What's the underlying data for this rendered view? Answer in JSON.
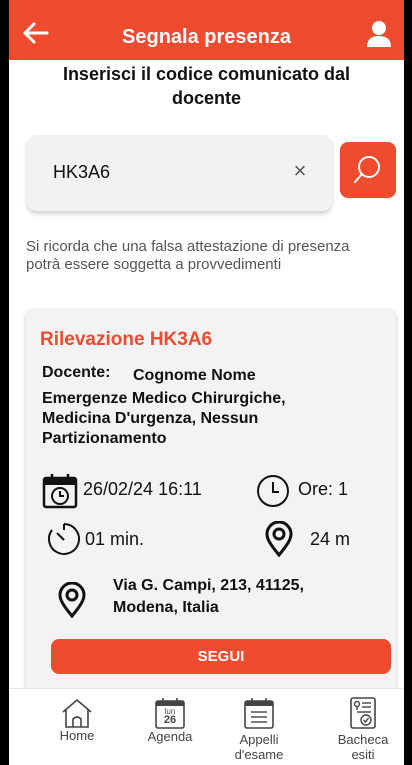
{
  "header": {
    "title": "Segnala presenza",
    "back_icon": "arrow-left-icon",
    "user_icon": "user-icon",
    "color": "#ef4c2f"
  },
  "instruction": "Inserisci il codice comunicato dal docente",
  "search": {
    "value": "HK3A6",
    "clear_label": "×",
    "search_icon": "search-icon"
  },
  "disclaimer": "Si ricorda che una falsa attestazione di presenza potrà essere soggetta a provvedimenti",
  "card": {
    "title": "Rilevazione HK3A6",
    "docente_label": "Docente:",
    "docente_name": "Cognome Nome",
    "course": "Emergenze Medico Chirurgiche, Medicina D'urgenza, Nessun Partizionamento",
    "datetime": "26/02/24 16:11",
    "hours": "Ore: 1",
    "duration": "01 min.",
    "distance": "24 m",
    "address": "Via G. Campi, 213, 41125, Modena, Italia",
    "button": "SEGUI"
  },
  "nav": {
    "home": "Home",
    "agenda": "Agenda",
    "agenda_day": "lun",
    "agenda_date": "26",
    "appelli_1": "Appelli",
    "appelli_2": "d'esame",
    "bacheca_1": "Bacheca",
    "bacheca_2": "esiti"
  }
}
